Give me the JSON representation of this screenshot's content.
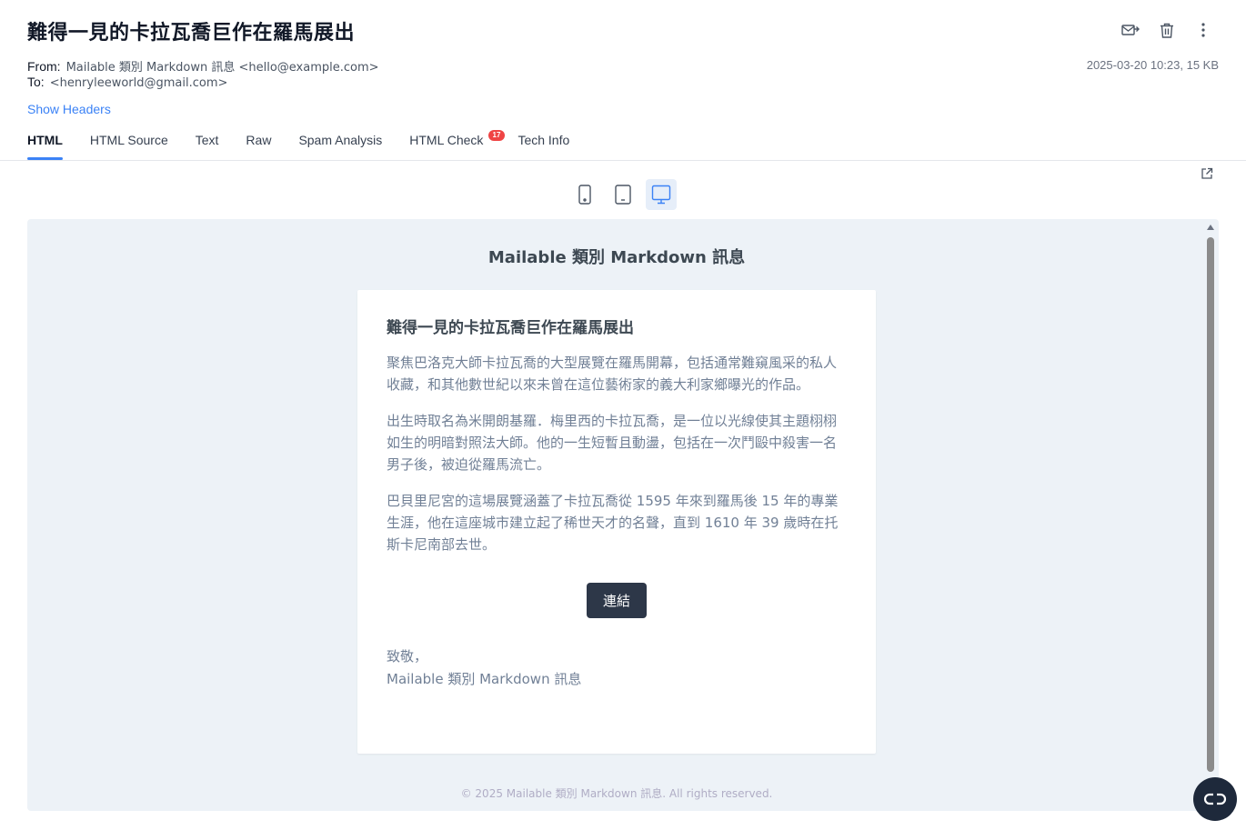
{
  "email": {
    "subject": "難得一見的卡拉瓦喬巨作在羅馬展出",
    "from_label": "From:",
    "from_value": "Mailable 類別 Markdown 訊息 <hello@example.com>",
    "to_label": "To:",
    "to_value": "<henryleeworld@gmail.com>",
    "date_size": "2025-03-20 10:23, 15 KB",
    "show_headers": "Show Headers"
  },
  "toolbar": {
    "icons": [
      "forward-mail-icon",
      "trash-icon",
      "more-vertical-icon"
    ]
  },
  "tabs": [
    {
      "label": "HTML",
      "active": true
    },
    {
      "label": "HTML Source"
    },
    {
      "label": "Text"
    },
    {
      "label": "Raw"
    },
    {
      "label": "Spam Analysis"
    },
    {
      "label": "HTML Check",
      "badge": "17"
    },
    {
      "label": "Tech Info"
    }
  ],
  "preview": {
    "devices": [
      "phone-icon",
      "tablet-icon",
      "desktop-icon"
    ],
    "active_device": "desktop",
    "mail": {
      "header": "Mailable 類別 Markdown 訊息",
      "title": "難得一見的卡拉瓦喬巨作在羅馬展出",
      "paragraphs": [
        "聚焦巴洛克大師卡拉瓦喬的大型展覽在羅馬開幕，包括通常難窺風采的私人收藏，和其他數世紀以來未曾在這位藝術家的義大利家鄉曝光的作品。",
        "出生時取名為米開朗基羅．梅里西的卡拉瓦喬，是一位以光線使其主題栩栩如生的明暗對照法大師。他的一生短暫且動盪，包括在一次鬥毆中殺害一名男子後，被迫從羅馬流亡。",
        "巴貝里尼宮的這場展覽涵蓋了卡拉瓦喬從 1595 年來到羅馬後 15 年的專業生涯，他在這座城市建立起了稀世天才的名聲，直到 1610 年 39 歲時在托斯卡尼南部去世。"
      ],
      "button": "連結",
      "signoff_line1": "致敬，",
      "signoff_line2": "Mailable 類別 Markdown 訊息",
      "footer": "© 2025 Mailable 類別 Markdown 訊息. All rights reserved."
    }
  },
  "colors": {
    "accent": "#3b82f6",
    "badge": "#ef4444",
    "preview_bg": "#edf2f7",
    "button_bg": "#2d3748"
  }
}
